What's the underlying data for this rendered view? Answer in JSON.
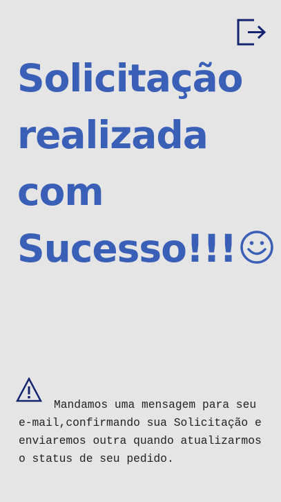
{
  "header": {
    "logout_icon": "logout-icon",
    "logout_color": "#14246e"
  },
  "headline": {
    "line1": "Solicitação",
    "line2": "realizada",
    "line3": "com",
    "line4": "Sucesso!!!",
    "emoji_icon": "smiley-face-icon",
    "color": "#3a5fb6"
  },
  "notice": {
    "icon": "warning-triangle-icon",
    "icon_color": "#14246e",
    "message": "Mandamos uma mensagem para seu e-mail,confirmando sua Solicitação e enviaremos outra quando atualizarmos o status de seu pedido."
  }
}
